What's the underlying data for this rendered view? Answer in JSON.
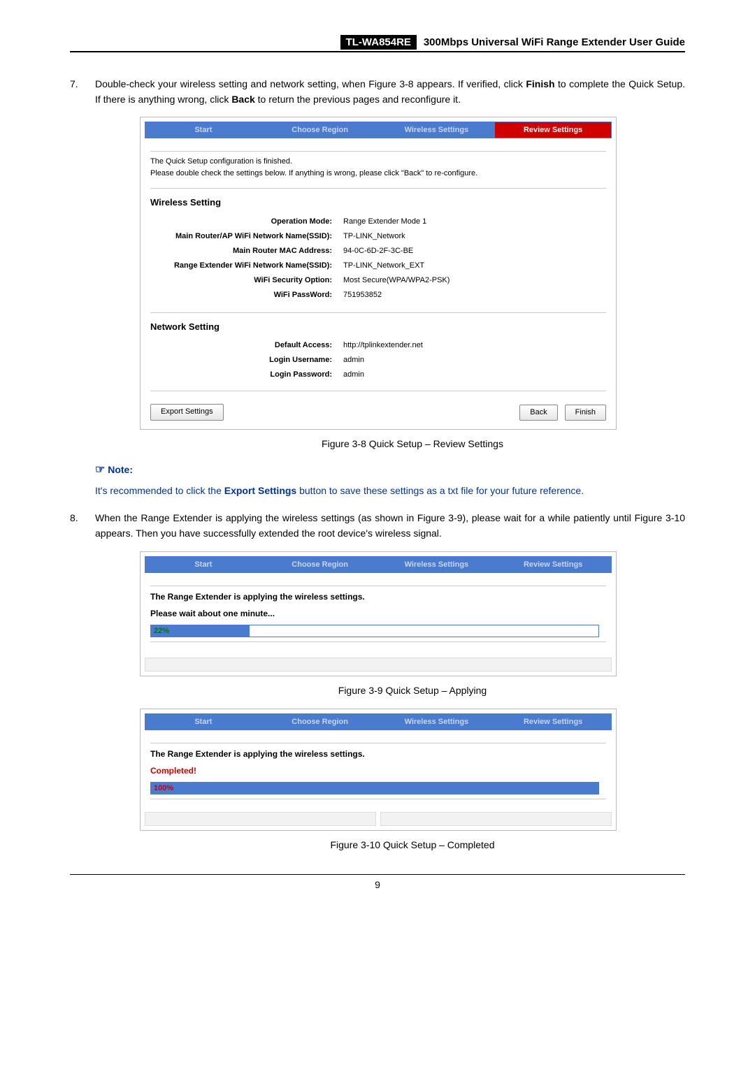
{
  "header": {
    "model": "TL-WA854RE",
    "title": "300Mbps Universal WiFi Range Extender User Guide"
  },
  "step7": {
    "num": "7.",
    "text_pre": "Double-check your wireless setting and network setting, when Figure 3-8 appears. If verified, click ",
    "bold1": "Finish",
    "text_mid": " to complete the Quick Setup. If there is anything wrong, click ",
    "bold2": "Back",
    "text_post": " to return the previous pages and reconfigure it."
  },
  "fig38": {
    "tabs": {
      "t1": "Start",
      "t2": "Choose Region",
      "t3": "Wireless Settings",
      "t4": "Review Settings"
    },
    "intro1": "The Quick Setup configuration is finished.",
    "intro2": "Please double check the settings below. If anything is wrong, please click \"Back\" to re-configure.",
    "wireless_head": "Wireless Setting",
    "wireless": {
      "op_mode_l": "Operation Mode:",
      "op_mode_v": "Range Extender Mode 1",
      "main_ssid_l": "Main Router/AP WiFi Network Name(SSID):",
      "main_ssid_v": "TP-LINK_Network",
      "main_mac_l": "Main Router MAC Address:",
      "main_mac_v": "94-0C-6D-2F-3C-BE",
      "ext_ssid_l": "Range Extender WiFi Network Name(SSID):",
      "ext_ssid_v": "TP-LINK_Network_EXT",
      "sec_l": "WiFi Security Option:",
      "sec_v": "Most Secure(WPA/WPA2-PSK)",
      "pw_l": "WiFi PassWord:",
      "pw_v": "751953852"
    },
    "network_head": "Network Setting",
    "network": {
      "access_l": "Default Access:",
      "access_v": "http://tplinkextender.net",
      "user_l": "Login Username:",
      "user_v": "admin",
      "pass_l": "Login Password:",
      "pass_v": "admin"
    },
    "btn_export": "Export Settings",
    "btn_back": "Back",
    "btn_finish": "Finish",
    "caption": "Figure 3-8 Quick Setup – Review Settings"
  },
  "note": {
    "head": "Note:",
    "body_pre": "It's recommended to click the ",
    "body_bold": "Export Settings",
    "body_post": " button to save these settings as a txt file for your future reference."
  },
  "step8": {
    "num": "8.",
    "text": "When the Range Extender is applying the wireless settings (as shown in Figure 3-9), please wait for a while patiently until Figure 3-10 appears. Then you have successfully extended the root device's wireless signal."
  },
  "fig39": {
    "tabs": {
      "t1": "Start",
      "t2": "Choose Region",
      "t3": "Wireless Settings",
      "t4": "Review Settings"
    },
    "line1": "The Range Extender is applying the wireless settings.",
    "line2": "Please wait about one minute...",
    "progress": "22%",
    "caption": "Figure 3-9 Quick Setup – Applying"
  },
  "fig310": {
    "tabs": {
      "t1": "Start",
      "t2": "Choose Region",
      "t3": "Wireless Settings",
      "t4": "Review Settings"
    },
    "line1": "The Range Extender is applying the wireless settings.",
    "completed": "Completed!",
    "progress": "100%",
    "caption": "Figure 3-10 Quick Setup – Completed"
  },
  "page_number": "9"
}
